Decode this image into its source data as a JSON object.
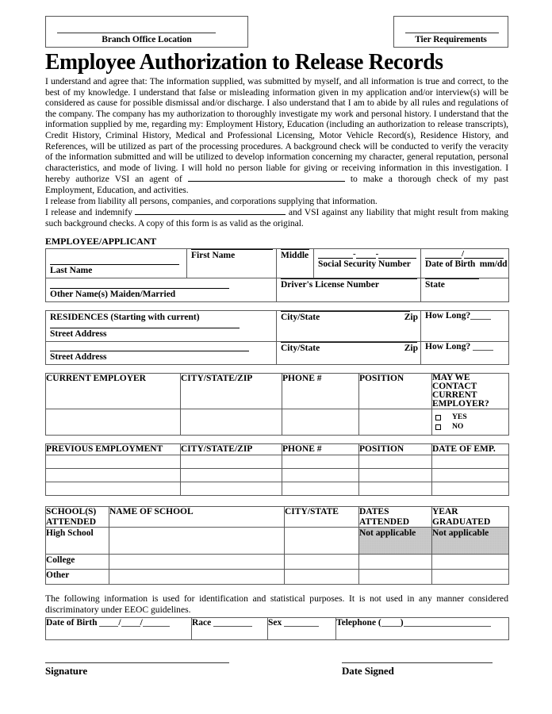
{
  "header": {
    "branch_office_label": "Branch Office Location",
    "tier_requirements_label": "Tier Requirements"
  },
  "title": "Employee Authorization to Release Records",
  "agreement": {
    "paragraph_1_part_a": "I understand and agree that: The information supplied, was submitted by myself, and all information is true and correct, to the best of my knowledge. I understand that false or misleading information given in my application and/or interview(s) will be considered as cause for possible dismissal and/or discharge. I also understand that I am to abide by all rules and regulations of the company. The company has my authorization to thoroughly investigate my work and personal history. I understand that the information supplied by me, regarding my: Employment History, Education (including an authorization to release transcripts), Credit History, Criminal History, Medical and Professional Licensing, Motor Vehicle Record(s), Residence History, and References, will be utilized as part of the processing procedures. A background check will be conducted to verify the veracity of the information submitted and will be utilized to develop information concerning my character, general reputation, personal characteristics, and mode of living. I will hold no person liable for giving or receiving information in this investigation.  I hereby authorize VSI an agent of",
    "paragraph_1_part_b": "to make a thorough check of my past Employment, Education, and activities.",
    "paragraph_2": "I release from liability all persons, companies, and corporations supplying that information.",
    "paragraph_3_part_a": "I release and indemnify",
    "paragraph_3_part_b": "and VSI against any liability that might result from making such background checks. A copy of this form is as valid as the original."
  },
  "employee_section": {
    "caption": "EMPLOYEE/APPLICANT",
    "last_name": "Last Name",
    "first_name": "First Name",
    "middle": "Middle",
    "social_security_number": "Social Security Number",
    "date_of_birth": "Date of Birth",
    "date_of_birth_format": "mm/dd",
    "other_names": "Other Name(s)   Maiden/Married",
    "drivers_license_number": "Driver's License Number",
    "state": "State"
  },
  "residences_section": {
    "caption": "RESIDENCES (Starting with current)",
    "street_address": "Street Address",
    "city_state": "City/State",
    "zip": "Zip",
    "how_long": "How Long?"
  },
  "current_employer_section": {
    "headers": [
      "CURRENT EMPLOYER",
      "CITY/STATE/ZIP",
      "PHONE #",
      "POSITION",
      "MAY WE CONTACT CURRENT EMPLOYER?"
    ],
    "contact_options": [
      "YES",
      "NO"
    ]
  },
  "previous_employment_section": {
    "headers": [
      "PREVIOUS EMPLOYMENT",
      "CITY/STATE/ZIP",
      "PHONE #",
      "POSITION",
      "DATE OF EMP."
    ],
    "row_count": 3
  },
  "school_section": {
    "headers": [
      "SCHOOL(S) ATTENDED",
      "NAME OF SCHOOL",
      "CITY/STATE",
      "DATES ATTENDED",
      "YEAR GRADUATED"
    ],
    "rows": [
      {
        "label": "High School",
        "name_of_school": "",
        "city_state": "",
        "dates_attended": "Not applicable",
        "dates_attended_shaded": true,
        "year_graduated": "Not applicable",
        "year_graduated_shaded": true
      },
      {
        "label": "College",
        "name_of_school": "",
        "city_state": "",
        "dates_attended": "",
        "dates_attended_shaded": false,
        "year_graduated": "",
        "year_graduated_shaded": false
      },
      {
        "label": "Other",
        "name_of_school": "",
        "city_state": "",
        "dates_attended": "",
        "dates_attended_shaded": false,
        "year_graduated": "",
        "year_graduated_shaded": false
      }
    ]
  },
  "eeoc_section": {
    "note": "The following information is used for identification and statistical purposes. It is not used in any manner considered discriminatory under EEOC guidelines.",
    "date_of_birth": "Date of Birth",
    "race": "Race",
    "sex": "Sex",
    "telephone": "Telephone ("
  },
  "signature_section": {
    "signature_label": "Signature",
    "date_signed_label": "Date Signed"
  },
  "colors": {
    "shade": "#c9c9c9",
    "border": "#5a5a5a",
    "text": "#000000"
  }
}
